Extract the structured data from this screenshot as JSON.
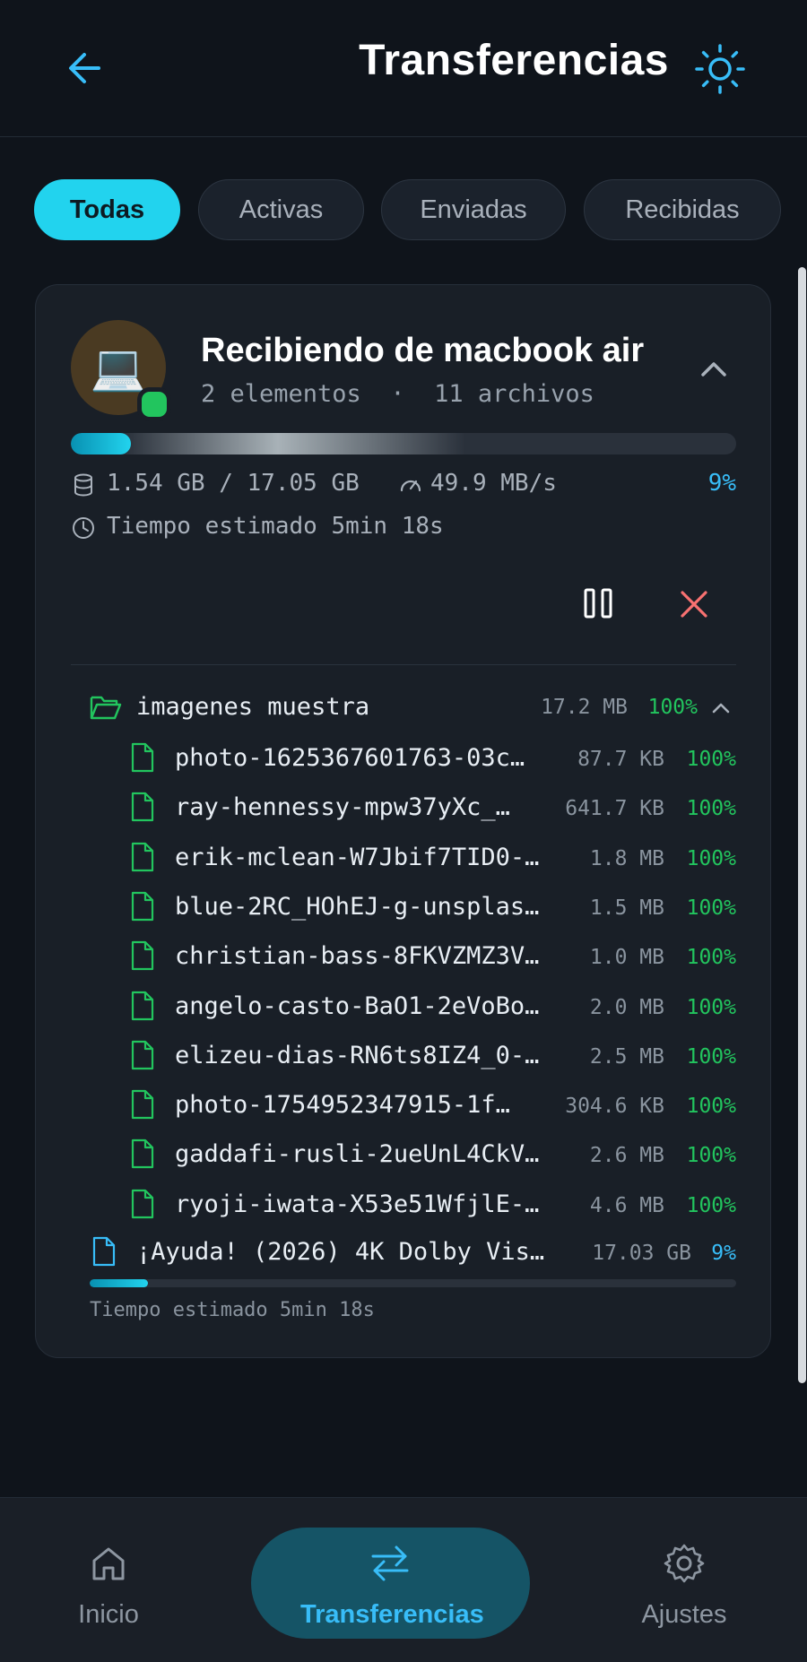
{
  "header": {
    "title": "Transferencias"
  },
  "tabs": [
    {
      "label": "Todas",
      "active": true
    },
    {
      "label": "Activas",
      "active": false
    },
    {
      "label": "Enviadas",
      "active": false
    },
    {
      "label": "Recibidas",
      "active": false
    }
  ],
  "transfer": {
    "title": "Recibiendo de macbook air",
    "subtitle": "2 elementos  ·  11 archivos",
    "device_emoji": "💻",
    "progress_fraction": 0.09,
    "size_text": "1.54 GB / 17.05 GB",
    "speed_text": "49.9 MB/s",
    "percent_text": "9%",
    "eta_text": "Tiempo estimado 5min 18s",
    "folder": {
      "name": "imagenes muestra",
      "size": "17.2 MB",
      "percent": "100%",
      "files": [
        {
          "name": "photo-1625367601763-03c…",
          "size": "87.7 KB",
          "percent": "100%"
        },
        {
          "name": "ray-hennessy-mpw37yXc_…",
          "size": "641.7 KB",
          "percent": "100%"
        },
        {
          "name": "erik-mclean-W7Jbif7TID0-…",
          "size": "1.8 MB",
          "percent": "100%"
        },
        {
          "name": "blue-2RC_HOhEJ-g-unsplas…",
          "size": "1.5 MB",
          "percent": "100%"
        },
        {
          "name": "christian-bass-8FKVZMZ3V…",
          "size": "1.0 MB",
          "percent": "100%"
        },
        {
          "name": "angelo-casto-BaO1-2eVoBo…",
          "size": "2.0 MB",
          "percent": "100%"
        },
        {
          "name": "elizeu-dias-RN6ts8IZ4_0-…",
          "size": "2.5 MB",
          "percent": "100%"
        },
        {
          "name": "photo-1754952347915-1f…",
          "size": "304.6 KB",
          "percent": "100%"
        },
        {
          "name": "gaddafi-rusli-2ueUnL4CkV…",
          "size": "2.6 MB",
          "percent": "100%"
        },
        {
          "name": "ryoji-iwata-X53e51WfjlE-…",
          "size": "4.6 MB",
          "percent": "100%"
        }
      ]
    },
    "big_file": {
      "name": "¡Ayuda! (2026) 4K Dolby Vis…",
      "size": "17.03 GB",
      "percent": "9%",
      "progress_fraction": 0.09,
      "eta_text": "Tiempo estimado 5min 18s"
    }
  },
  "bottom_nav": [
    {
      "label": "Inicio",
      "icon": "home-icon"
    },
    {
      "label": "Transferencias",
      "icon": "transfer-arrows-icon",
      "active": true
    },
    {
      "label": "Ajustes",
      "icon": "gear-icon"
    }
  ],
  "colors": {
    "accent": "#22d3ee",
    "success": "#22c55e",
    "danger": "#f87171",
    "background": "#0f141b"
  }
}
